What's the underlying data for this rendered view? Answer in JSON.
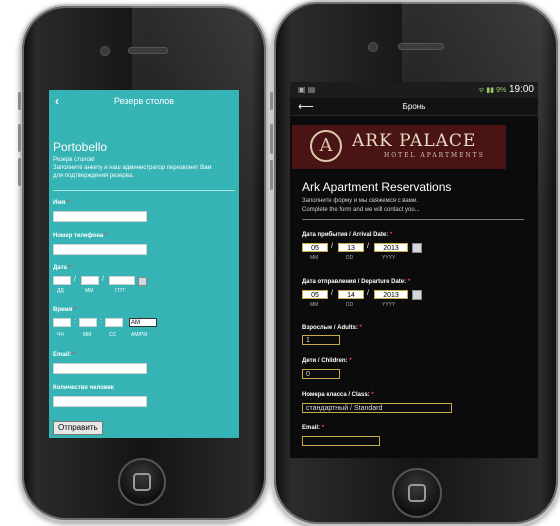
{
  "left_app": {
    "header_title": "Резерв столов",
    "back_glyph": "‹",
    "venue_name": "Portobello",
    "intro_line1": "Резерв столов!",
    "intro_line2": "Заполните анкету и наш администратор перезвонит Вам",
    "intro_line3": "для подтверждения резерва.",
    "required_mark": "*",
    "fields": {
      "name_label": "Имя",
      "phone_label": "Номер телефона",
      "date_label": "Дата",
      "date_sub_day": "ДД",
      "date_sub_month": "ММ",
      "date_sub_year": "ГГГГ",
      "time_label": "Время",
      "time_sub_hour": "ЧЧ",
      "time_sub_min": "ММ",
      "time_sub_sec": "СС",
      "time_sub_ampm": "AM/PM",
      "ampm_value": "AM",
      "email_label": "Email:",
      "guests_label": "Количество человек"
    },
    "submit_label": "Отправить",
    "slash": "/",
    "colon": ":"
  },
  "right_app": {
    "status_time": "19:00",
    "status_icons": "▣ ▤",
    "status_signal": "ᯤ ▮▮ 9%",
    "action_title": "Бронь",
    "back_glyph": "⟵",
    "banner_emblem": "A",
    "banner_name": "Ark Palace",
    "banner_sub": "HOTEL APARTMENTS",
    "form_title": "Ark Apartment Reservations",
    "intro_line1": "Заполните форму и мы свяжемся с вами.",
    "intro_line2": "Complete the form and we will contact you...",
    "required_mark": "*",
    "arrival_label": "Дата прибытия / Arrival Date:",
    "arrival_mm": "05",
    "arrival_dd": "13",
    "arrival_yyyy": "2013",
    "departure_label": "Дата отправления / Departure Date:",
    "departure_mm": "05",
    "departure_dd": "14",
    "departure_yyyy": "2013",
    "sub_mm": "MM",
    "sub_dd": "DD",
    "sub_yyyy": "YYYY",
    "adults_label": "Взрослые / Adults:",
    "adults_value": "1",
    "children_label": "Дети / Children:",
    "children_value": "0",
    "class_label": "Номера класса / Class:",
    "class_value": "стандартный / Standard",
    "email_label": "Email:",
    "slash": "/"
  },
  "icons": {
    "back_arrow": "back-arrow-icon",
    "calendar": "calendar-icon",
    "home": "home-button-icon",
    "camera": "camera-icon",
    "speaker": "speaker-icon"
  },
  "colors": {
    "left_screen_bg": "#36b3b5",
    "right_screen_bg": "#0b0b0b",
    "banner_bg": "#4a1414",
    "required": "#ff3b3b",
    "input_border_gold": "#c9a84a"
  }
}
